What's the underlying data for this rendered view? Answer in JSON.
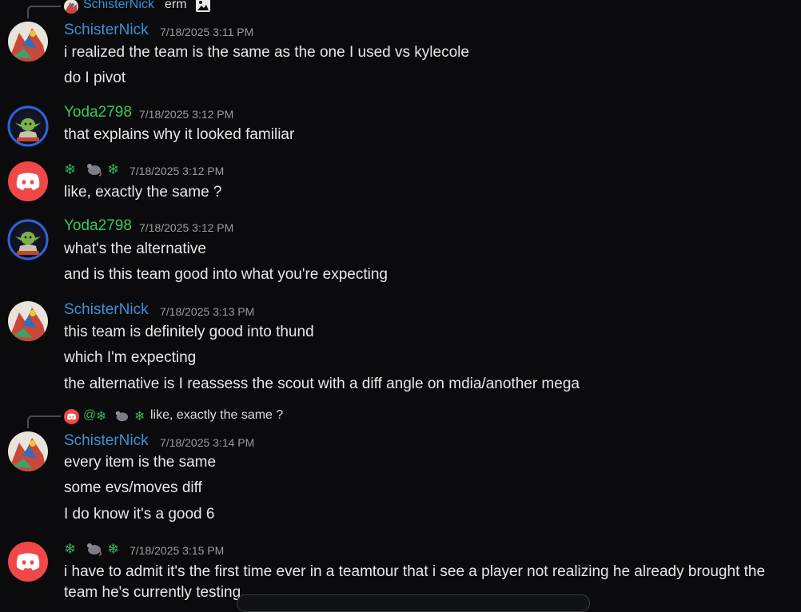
{
  "reply1": {
    "author": "SchisterNick",
    "text": "erm"
  },
  "reply2": {
    "mention": "@",
    "text": "like, exactly the same ?"
  },
  "snowflake": "❄",
  "colors": {
    "blue_name": "#3f90d6",
    "green_name": "#37c95c",
    "discord_red": "#f04848"
  },
  "messages": [
    {
      "author": "SchisterNick",
      "time": "7/18/2025 3:11 PM",
      "lines": [
        "i realized the team is the same as the one I used vs kylecole",
        "do I pivot"
      ]
    },
    {
      "author": "Yoda2798",
      "time": "7/18/2025 3:12 PM",
      "lines": [
        "that explains why it looked familiar"
      ]
    },
    {
      "author": "",
      "time": "7/18/2025 3:12 PM",
      "lines": [
        "like, exactly the same ?"
      ]
    },
    {
      "author": "Yoda2798",
      "time": "7/18/2025 3:12 PM",
      "lines": [
        "what's the alternative",
        "and is this team good into what you're expecting"
      ]
    },
    {
      "author": "SchisterNick",
      "time": "7/18/2025 3:13 PM",
      "lines": [
        "this team is definitely good into thund",
        "which I'm expecting",
        "the alternative is I reassess the scout with a diff angle on mdia/another mega"
      ]
    },
    {
      "author": "SchisterNick",
      "time": "7/18/2025 3:14 PM",
      "lines": [
        "every item is the same",
        "some evs/moves diff",
        "I do know it's a good 6"
      ]
    },
    {
      "author": "",
      "time": "7/18/2025 3:15 PM",
      "lines": [
        "i have to admit it's the first time ever in a teamtour that i see a player not realizing he already brought the",
        "team he's currently testing"
      ]
    }
  ]
}
